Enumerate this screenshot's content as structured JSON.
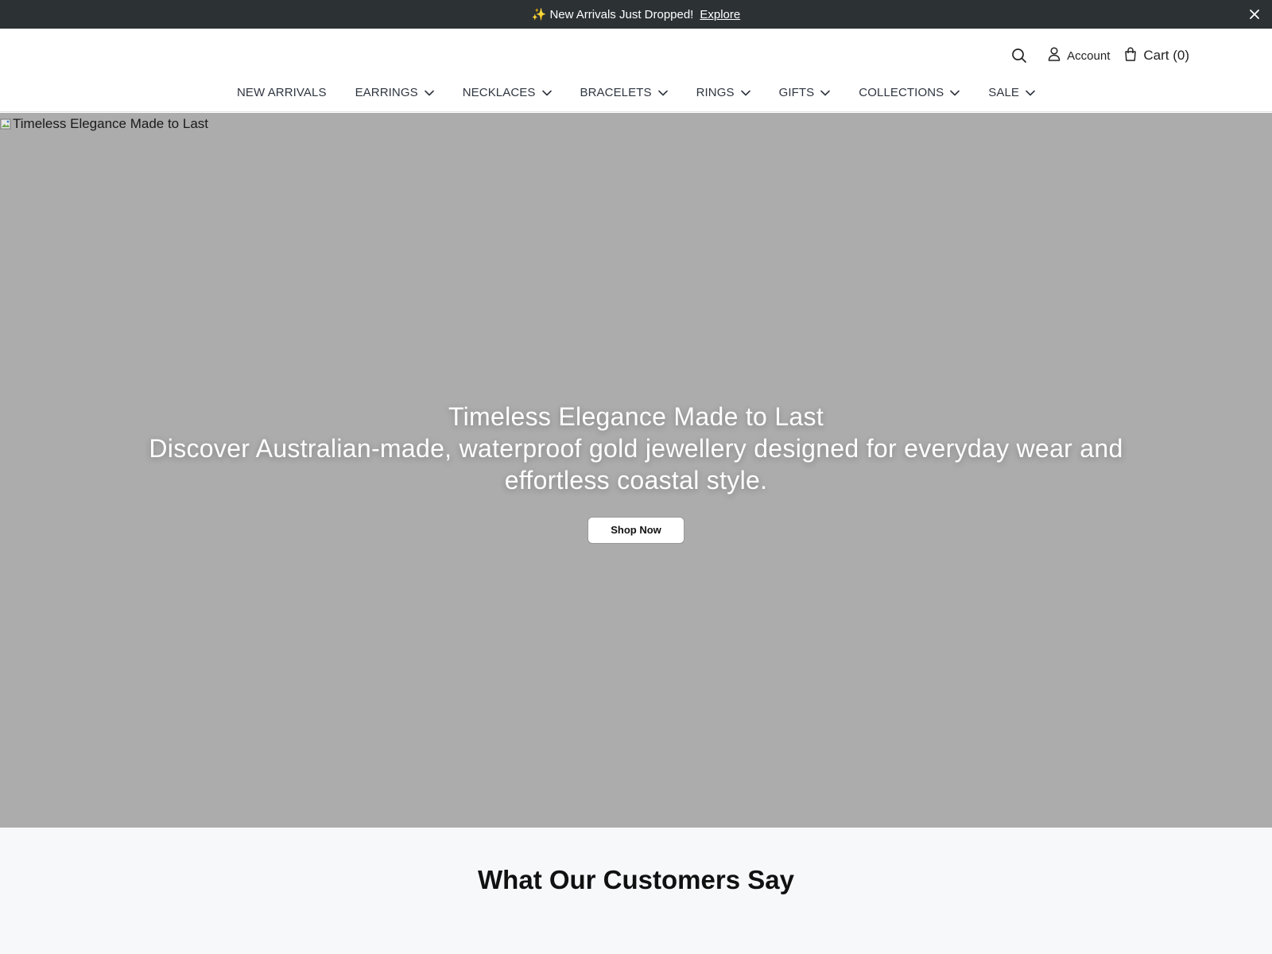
{
  "announcement": {
    "sparkle": "✨",
    "text": "New Arrivals Just Dropped!",
    "link_label": "Explore",
    "close_icon": "close-icon"
  },
  "header": {
    "search_icon": "search-icon",
    "account_label": "Account",
    "cart_label": "Cart (0)"
  },
  "nav": {
    "items": [
      {
        "label": "NEW ARRIVALS",
        "has_dropdown": false
      },
      {
        "label": "EARRINGS",
        "has_dropdown": true
      },
      {
        "label": "NECKLACES",
        "has_dropdown": true
      },
      {
        "label": "BRACELETS",
        "has_dropdown": true
      },
      {
        "label": "RINGS",
        "has_dropdown": true
      },
      {
        "label": "GIFTS",
        "has_dropdown": true
      },
      {
        "label": "COLLECTIONS",
        "has_dropdown": true
      },
      {
        "label": "SALE",
        "has_dropdown": true
      }
    ]
  },
  "hero": {
    "image_alt": "Timeless Elegance Made to Last",
    "title": "Timeless Elegance Made to Last",
    "subtitle": "Discover Australian-made, waterproof gold jewellery designed for everyday wear and effortless coastal style.",
    "cta_label": "Shop Now",
    "background_color": "#acacac"
  },
  "testimonials": {
    "heading": "What Our Customers Say"
  },
  "colors": {
    "announcement_bg": "#2c3134",
    "nav_text": "#2f3640",
    "testimonials_bg": "#f7f8fa"
  }
}
